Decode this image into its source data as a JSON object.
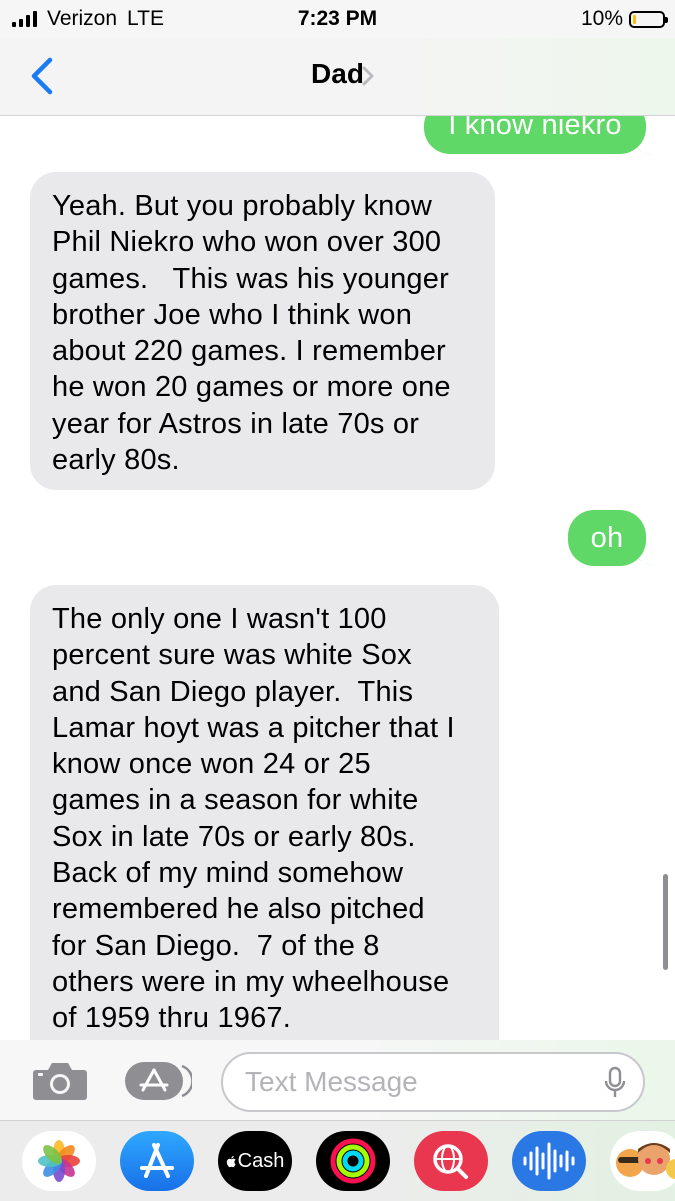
{
  "status_bar": {
    "carrier": "Verizon",
    "network": "LTE",
    "time": "7:23 PM",
    "battery_percent": "10%",
    "battery_level": 0.1
  },
  "nav": {
    "back_icon": "chevron-left-icon",
    "contact_name": "Dad",
    "detail_icon": "chevron-right-icon"
  },
  "messages": [
    {
      "direction": "outgoing",
      "text": "I know niekro"
    },
    {
      "direction": "incoming",
      "lines": [
        "Yeah. But you probably know",
        "Phil Niekro who won over 300",
        "games.   This was his younger",
        "brother Joe who I think won",
        "about 220 games. I remember",
        "he won 20 games or more one",
        "year for Astros in late 70s or",
        "early 80s."
      ]
    },
    {
      "direction": "outgoing",
      "text": "oh"
    },
    {
      "direction": "incoming",
      "lines": [
        "The only one I wasn't 100",
        "percent sure was white Sox",
        "and San Diego player.  This",
        "Lamar hoyt was a pitcher that I",
        "know once won 24 or 25",
        "games in a season for white",
        "Sox in late 70s or early 80s.",
        "Back of my mind somehow",
        "remembered he also pitched",
        "for San Diego.  7 of the 8",
        "others were in my wheelhouse",
        "of 1959 thru 1967."
      ]
    }
  ],
  "compose": {
    "camera_icon": "camera-icon",
    "apps_icon": "app-store-icon",
    "placeholder": "Text Message",
    "value": "",
    "mic_icon": "microphone-icon"
  },
  "app_drawer": [
    {
      "name": "photos",
      "icon": "photos-icon",
      "label": ""
    },
    {
      "name": "app-store",
      "icon": "app-store-icon",
      "label": ""
    },
    {
      "name": "cash",
      "icon": "apple-cash-icon",
      "label": "Cash"
    },
    {
      "name": "activity",
      "icon": "activity-rings-icon",
      "label": ""
    },
    {
      "name": "web-search",
      "icon": "web-search-icon",
      "label": ""
    },
    {
      "name": "audio",
      "icon": "audio-waveform-icon",
      "label": ""
    },
    {
      "name": "memoji",
      "icon": "memoji-icon",
      "label": ""
    }
  ],
  "colors": {
    "accent_blue": "#1a7cf5",
    "outgoing_bubble": "#5fd867",
    "incoming_bubble": "#e9e9eb",
    "battery_low": "#f4c20d"
  }
}
